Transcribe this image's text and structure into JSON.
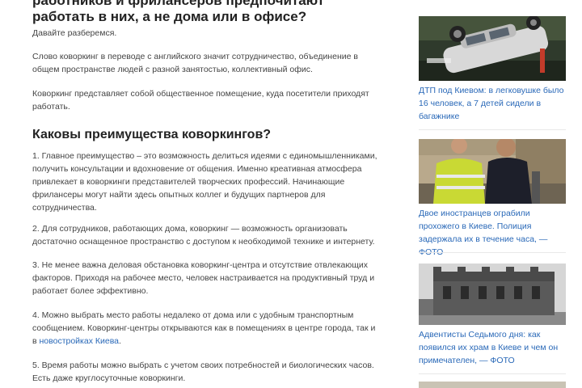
{
  "article": {
    "title": "работников и фрилансеров предпочитают работать в них, а не дома или в офисе?",
    "p1": "Давайте разберемся.",
    "p2": "Слово коворкинг в переводе с английского значит сотрудничество, объединение в общем пространстве людей с разной занятостью, коллективный офис.",
    "p3": "Коворкинг представляет собой общественное помещение, куда посетители приходят работать.",
    "h2": "Каковы преимущества коворкингов?",
    "item1": "1. Главное преимущество – это возможность делиться идеями с единомышленниками, получить консультации и вдохновение от общения. Именно креативная атмосфера привлекает в коворкинги представителей творческих профессий. Начинающие фрилансеры могут найти здесь опытных коллег и будущих партнеров для сотрудничества.",
    "item2": "2. Для сотрудников, работающих дома, коворкинг — возможность организовать достаточно оснащенное пространство с доступом к необходимой технике и интернету.",
    "item3": "3. Не менее важна деловая обстановка коворкинг-центра и отсутствие отвлекающих факторов. Приходя на рабочее место, человек настраивается на продуктивный труд и работает более эффективно.",
    "item4_text": "4. Можно выбрать место работы недалеко от дома или с удобным транспортным сообщением. Коворкинг-центры открываются как в помещениях в центре города, так и в",
    "item4_link": "новостройках Киева",
    "item4_end": ".",
    "item5": "5. Время работы можно выбрать с учетом своих потребностей и биологических часов. Есть даже круглосуточные коворкинги."
  },
  "sidebar": {
    "items": [
      {
        "caption": "ДТП под Киевом: в легковушке было 16 человек, а 7 детей сидели в багажнике"
      },
      {
        "caption": "Двое иностранцев ограбили прохожего в Киеве. Полиция задержала их в течение часа, — ФОТО"
      },
      {
        "caption": "Адвентисты Седьмого дня: как появился их храм в Киеве и чем он примечателен, — ФОТО"
      }
    ]
  },
  "colors": {
    "link": "#2a69b8",
    "text": "#444444",
    "heading": "#222222"
  }
}
